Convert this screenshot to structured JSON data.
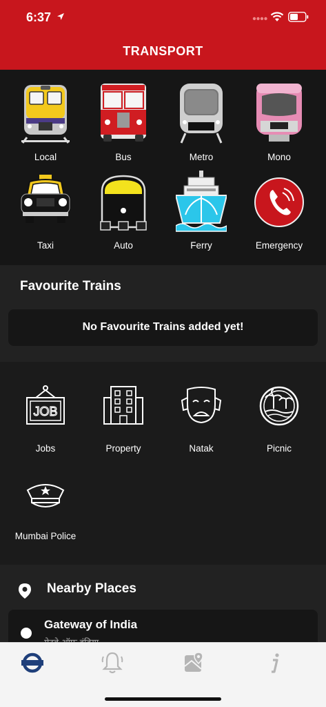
{
  "status": {
    "time": "6:37"
  },
  "header": {
    "title": "TRANSPORT"
  },
  "transport": {
    "items": [
      {
        "label": "Local",
        "icon": "local-train-icon"
      },
      {
        "label": "Bus",
        "icon": "bus-icon"
      },
      {
        "label": "Metro",
        "icon": "metro-icon"
      },
      {
        "label": "Mono",
        "icon": "monorail-icon"
      },
      {
        "label": "Taxi",
        "icon": "taxi-icon"
      },
      {
        "label": "Auto",
        "icon": "auto-rickshaw-icon"
      },
      {
        "label": "Ferry",
        "icon": "ferry-icon"
      },
      {
        "label": "Emergency",
        "icon": "emergency-phone-icon"
      }
    ]
  },
  "favourites": {
    "title": "Favourite Trains",
    "empty_message": "No Favourite Trains added yet!"
  },
  "services": {
    "items": [
      {
        "label": "Jobs",
        "icon": "job-board-icon"
      },
      {
        "label": "Property",
        "icon": "building-icon"
      },
      {
        "label": "Natak",
        "icon": "drama-mask-icon"
      },
      {
        "label": "Picnic",
        "icon": "beach-icon"
      },
      {
        "label": "Mumbai Police",
        "icon": "police-cap-icon"
      }
    ]
  },
  "nearby": {
    "title": "Nearby Places",
    "places": [
      {
        "name": "Gateway of India",
        "subtitle": "गेटवे ऑफ इंडिया"
      }
    ]
  },
  "tabs": [
    {
      "name": "home-tab",
      "icon": "transit-roundel-icon",
      "active": true
    },
    {
      "name": "alerts-tab",
      "icon": "bell-icon",
      "active": false
    },
    {
      "name": "map-tab",
      "icon": "map-icon",
      "active": false
    },
    {
      "name": "info-tab",
      "icon": "info-icon",
      "active": false
    }
  ],
  "colors": {
    "brand_red": "#c8161d",
    "background": "#1b1b1b",
    "tab_active": "#1f3f7a",
    "tab_inactive": "#b5b5b5"
  }
}
